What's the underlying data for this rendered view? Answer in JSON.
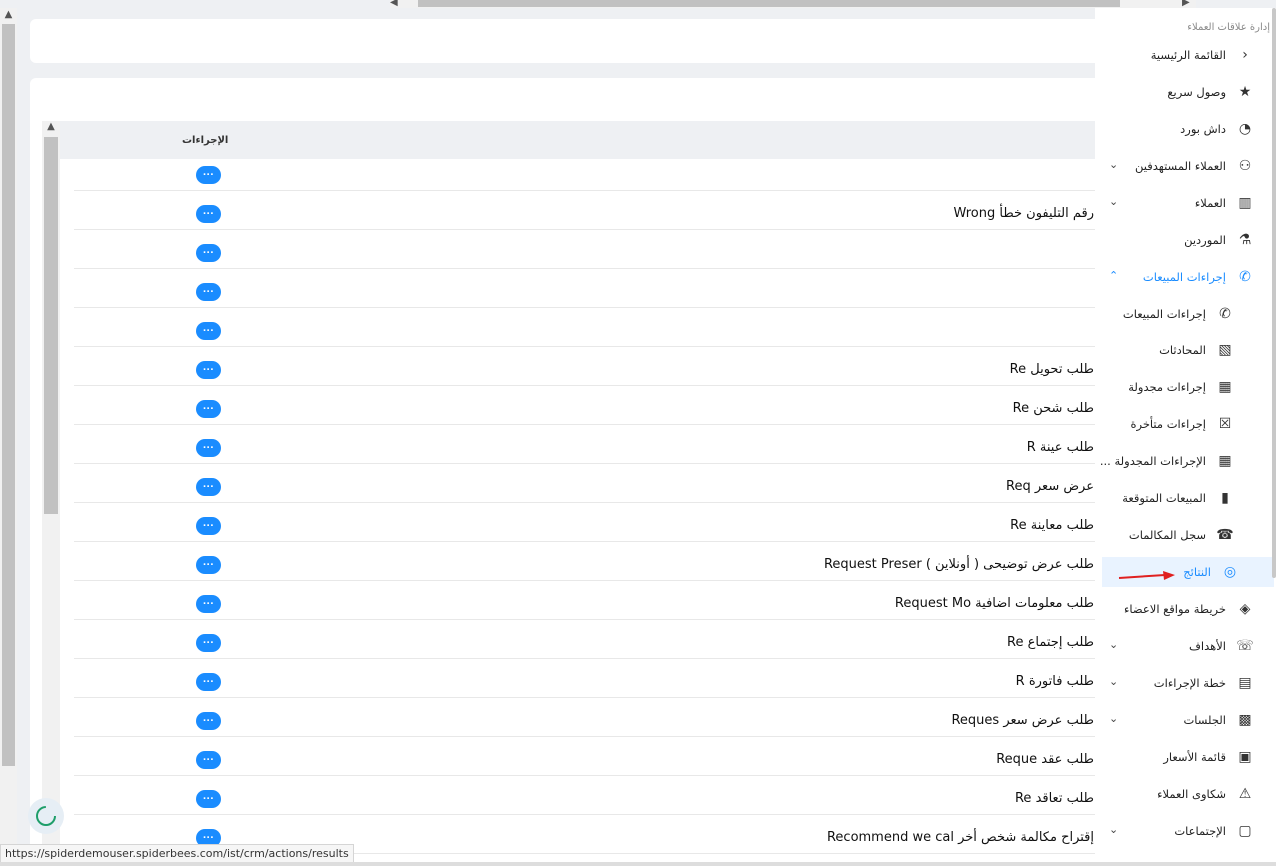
{
  "sidebar": {
    "title": "إدارة علاقات العملاء",
    "items": [
      {
        "label": "القائمة الرئيسية",
        "icon": "chevron-left-icon",
        "glyph": "‹"
      },
      {
        "label": "وصول سريع",
        "icon": "star-icon",
        "glyph": "★"
      },
      {
        "label": "داش بورد",
        "icon": "gauge-icon",
        "glyph": "◔"
      },
      {
        "label": "العملاء المستهدفين",
        "icon": "users-icon",
        "glyph": "⚇"
      },
      {
        "label": "العملاء",
        "icon": "building-icon",
        "glyph": "▥"
      },
      {
        "label": "الموردين",
        "icon": "supplier-icon",
        "glyph": "⚗"
      },
      {
        "label": "إجراءات المبيعات",
        "icon": "phone-call-icon",
        "glyph": "✆"
      },
      {
        "label": "إجراءات المبيعات",
        "icon": "phone-icon",
        "glyph": "✆"
      },
      {
        "label": "المحادثات",
        "icon": "chat-off-icon",
        "glyph": "▧"
      },
      {
        "label": "إجراءات مجدولة",
        "icon": "calendar-icon",
        "glyph": "▦"
      },
      {
        "label": "إجراءات متأخرة",
        "icon": "calendar-x-icon",
        "glyph": "☒"
      },
      {
        "label": "الإجراءات المجدولة ...",
        "icon": "calendar-list-icon",
        "glyph": "▦"
      },
      {
        "label": "المبيعات المتوقعة",
        "icon": "bar-chart-icon",
        "glyph": "▮"
      },
      {
        "label": "سجل المكالمات",
        "icon": "telephone-icon",
        "glyph": "☎"
      },
      {
        "label": "النتائج",
        "icon": "target-icon",
        "glyph": "◎"
      },
      {
        "label": "خريطة مواقع الاعضاء",
        "icon": "location-icon",
        "glyph": "◈"
      },
      {
        "label": "الأهداف",
        "icon": "goals-icon",
        "glyph": "☏"
      },
      {
        "label": "خطة الإجراءات",
        "icon": "plan-icon",
        "glyph": "▤"
      },
      {
        "label": "الجلسات",
        "icon": "sessions-icon",
        "glyph": "▩"
      },
      {
        "label": "قائمة الأسعار",
        "icon": "price-list-icon",
        "glyph": "▣"
      },
      {
        "label": "شكاوى العملاء",
        "icon": "warning-icon",
        "glyph": "⚠"
      },
      {
        "label": "الإجتماعات",
        "icon": "meetings-icon",
        "glyph": "▢"
      }
    ]
  },
  "table": {
    "actions_header": "الإجراءات",
    "action_button_label": "···",
    "rows": [
      {
        "text": ""
      },
      {
        "text": "Wrong رقم التليفون خطأ"
      },
      {
        "text": ""
      },
      {
        "text": ""
      },
      {
        "text": ""
      },
      {
        "text": "Re طلب تحويل"
      },
      {
        "text": "Re طلب شحن"
      },
      {
        "text": "R طلب عينة"
      },
      {
        "text": "Req عرض سعر"
      },
      {
        "text": "Re طلب معاينة"
      },
      {
        "text": "Request Preser طلب عرض توضيحى ( أونلاين )"
      },
      {
        "text": "Request Mo طلب معلومات اضافية"
      },
      {
        "text": "Re طلب إجتماع"
      },
      {
        "text": "R طلب فاتورة"
      },
      {
        "text": "Reques طلب عرض سعر"
      },
      {
        "text": "Reque طلب عقد"
      },
      {
        "text": "Re طلب تعاقد"
      },
      {
        "text": "Recommend we cal إقتراح مكالمة شخص أخر"
      }
    ]
  },
  "status": {
    "url": "https://spiderdemouser.spiderbees.com/ist/crm/actions/results"
  },
  "colors": {
    "accent": "#1a8cff",
    "arrow": "#e02020"
  }
}
